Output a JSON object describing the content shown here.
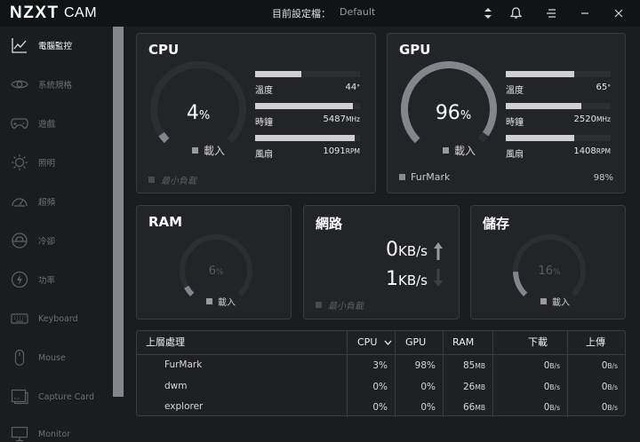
{
  "app": {
    "logo": "NZXT",
    "logo_suffix": "CAM",
    "profile_label": "目前設定檔：",
    "profile_value": "Default"
  },
  "sidebar": {
    "items": [
      {
        "label": "電腦監控",
        "icon": "line-chart-icon",
        "active": true
      },
      {
        "label": "系統規格",
        "icon": "eye-icon"
      },
      {
        "label": "遊戲",
        "icon": "gamepad-icon"
      },
      {
        "label": "照明",
        "icon": "sun-icon"
      },
      {
        "label": "超頻",
        "icon": "speedometer-icon"
      },
      {
        "label": "冷卻",
        "icon": "fan-icon"
      },
      {
        "label": "功率",
        "icon": "lightning-icon"
      },
      {
        "label": "Keyboard",
        "icon": "keyboard-icon"
      },
      {
        "label": "Mouse",
        "icon": "mouse-icon"
      },
      {
        "label": "Capture Card",
        "icon": "capture-card-icon"
      },
      {
        "label": "Monitor",
        "icon": "monitor-icon"
      }
    ]
  },
  "cpu": {
    "title": "CPU",
    "load_value": "4",
    "load_unit": "%",
    "load_label": "載入",
    "load_fraction": 0.04,
    "temp_label": "溫度",
    "temp_value": "44",
    "temp_unit": "°",
    "temp_fraction": 0.44,
    "clock_label": "時鐘",
    "clock_value": "5487",
    "clock_unit": "MHz",
    "clock_fraction": 0.93,
    "fan_label": "風扇",
    "fan_value": "1091",
    "fan_unit": "RPM",
    "fan_fraction": 0.95,
    "min_load_label": "最小負載"
  },
  "gpu": {
    "title": "GPU",
    "load_value": "96",
    "load_unit": "%",
    "load_label": "載入",
    "load_fraction": 0.96,
    "temp_label": "溫度",
    "temp_value": "65",
    "temp_unit": "°",
    "temp_fraction": 0.65,
    "clock_label": "時鐘",
    "clock_value": "2520",
    "clock_unit": "MHz",
    "clock_fraction": 0.72,
    "fan_label": "風扇",
    "fan_value": "1408",
    "fan_unit": "RPM",
    "fan_fraction": 0.65,
    "top_process": "FurMark",
    "top_process_value": "98%"
  },
  "ram": {
    "title": "RAM",
    "load_value": "6",
    "load_unit": "%",
    "load_label": "載入",
    "load_fraction": 0.06
  },
  "network": {
    "title": "網路",
    "down_value": "0",
    "down_unit": "KB/s",
    "up_value": "1",
    "up_unit": "KB/s",
    "min_load_label": "最小負載"
  },
  "storage": {
    "title": "儲存",
    "load_value": "16",
    "load_unit": "%",
    "load_label": "載入",
    "load_fraction": 0.16
  },
  "processes": {
    "headers": {
      "name": "上層處理",
      "cpu": "CPU",
      "gpu": "GPU",
      "ram": "RAM",
      "download": "下載",
      "upload": "上傳"
    },
    "rows": [
      {
        "name": "FurMark",
        "cpu": "3%",
        "gpu": "98%",
        "ram": "85",
        "ram_unit": "MB",
        "download": "0",
        "download_unit": "B/s",
        "upload": "0",
        "upload_unit": "B/s"
      },
      {
        "name": "dwm",
        "cpu": "0%",
        "gpu": "0%",
        "ram": "26",
        "ram_unit": "MB",
        "download": "0",
        "download_unit": "B/s",
        "upload": "0",
        "upload_unit": "B/s"
      },
      {
        "name": "explorer",
        "cpu": "0%",
        "gpu": "0%",
        "ram": "66",
        "ram_unit": "MB",
        "download": "0",
        "download_unit": "B/s",
        "upload": "0",
        "upload_unit": "B/s"
      }
    ]
  },
  "colors": {
    "background": "#1b1c1f",
    "card": "#232427",
    "gauge_track": "#2d2e31",
    "gauge_fill": "#85858c",
    "bar_fill": "#d0d0d3",
    "sidebar_scroll": "#85858c"
  }
}
